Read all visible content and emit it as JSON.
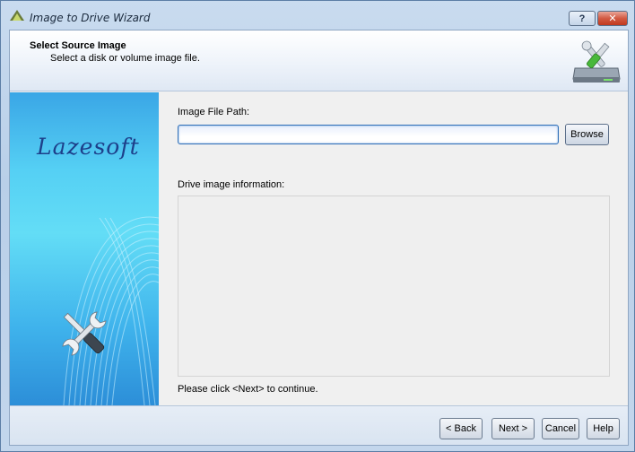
{
  "window": {
    "title": "Image to Drive Wizard",
    "help_label": "?",
    "close_label": "✕"
  },
  "header": {
    "title": "Select Source Image",
    "subtitle": "Select a disk or volume image file."
  },
  "banner": {
    "brand": "Lazesoft"
  },
  "form": {
    "path_label": "Image File Path:",
    "path_value": "",
    "browse_label": "Browse",
    "info_label": "Drive image information:",
    "info_text": "",
    "hint": "Please click <Next> to continue."
  },
  "footer": {
    "back_label": "< Back",
    "next_label": "Next >",
    "cancel_label": "Cancel",
    "help_label": "Help"
  },
  "colors": {
    "banner_top": "#3aa6e6",
    "banner_mid": "#63ddf6",
    "brand_text": "#1d3f8a",
    "input_border": "#2f6fb8",
    "close_red": "#c0391f"
  }
}
